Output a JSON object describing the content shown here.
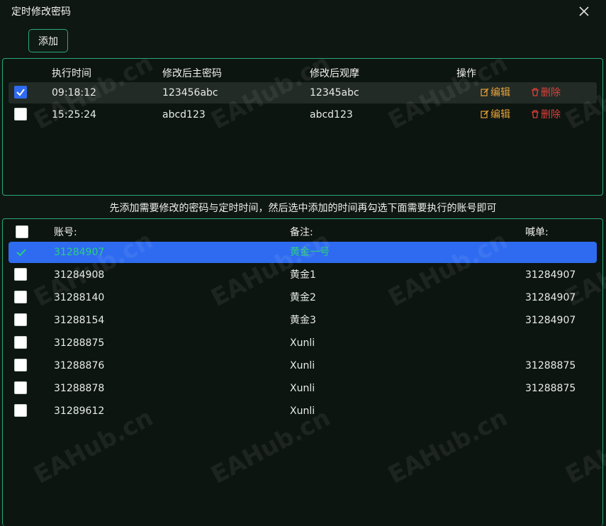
{
  "window": {
    "title": "定时修改密码"
  },
  "toolbar": {
    "add_label": "添加"
  },
  "schedule": {
    "headers": {
      "time": "执行时间",
      "master_pwd": "修改后主密码",
      "investor_pwd": "修改后观摩",
      "ops": "操作"
    },
    "rows": [
      {
        "time": "09:18:12",
        "master_pwd": "123456abc",
        "investor_pwd": "12345abc",
        "checked": true
      },
      {
        "time": "15:25:24",
        "master_pwd": "abcd123",
        "investor_pwd": "abcd123",
        "checked": false
      }
    ],
    "edit_label": "编辑",
    "delete_label": "删除"
  },
  "hint": "先添加需要修改的密码与定时时间，然后选中添加的时间再勾选下面需要执行的账号即可",
  "accounts": {
    "headers": {
      "account": "账号:",
      "remark": "备注:",
      "shout": "喊单:"
    },
    "rows": [
      {
        "account": "31284907",
        "remark": "黄金一号",
        "shout": "",
        "checked": true
      },
      {
        "account": "31284908",
        "remark": "黄金1",
        "shout": "31284907",
        "checked": false
      },
      {
        "account": "31288140",
        "remark": "黄金2",
        "shout": "31284907",
        "checked": false
      },
      {
        "account": "31288154",
        "remark": "黄金3",
        "shout": "31284907",
        "checked": false
      },
      {
        "account": "31288875",
        "remark": "Xunli",
        "shout": "",
        "checked": false
      },
      {
        "account": "31288876",
        "remark": "Xunli",
        "shout": "31288875",
        "checked": false
      },
      {
        "account": "31288878",
        "remark": "Xunli",
        "shout": "31288875",
        "checked": false
      },
      {
        "account": "31289612",
        "remark": "Xunli",
        "shout": "",
        "checked": false
      }
    ]
  },
  "watermark": "EAHub.cn",
  "colors": {
    "accent": "#2aa87a",
    "selected": "#2f6bf0",
    "edit": "#e8a33a",
    "delete": "#e0403a"
  }
}
